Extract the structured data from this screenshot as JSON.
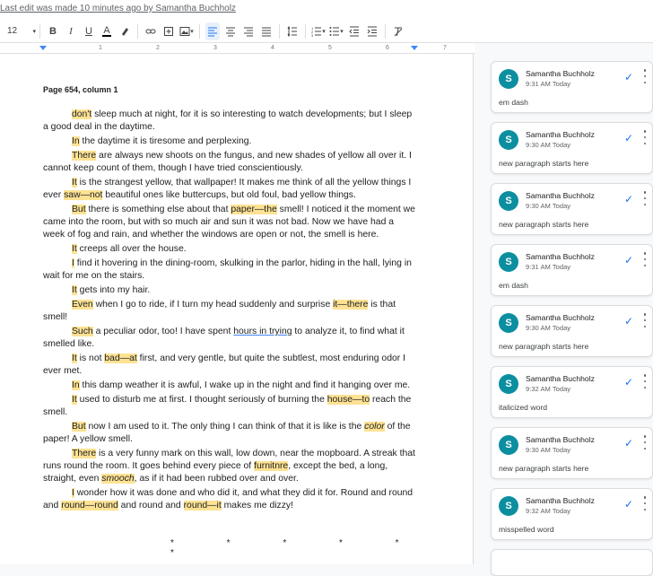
{
  "topbar": {
    "last_edit": "Last edit was made 10 minutes ago by Samantha Buchholz"
  },
  "toolbar": {
    "font_size": "12",
    "icons": [
      "bold-icon",
      "italic-icon",
      "underline-icon",
      "text-color-icon",
      "highlight-icon",
      "link-icon",
      "comment-icon",
      "image-icon",
      "align-left-icon",
      "align-center-icon",
      "align-right-icon",
      "justify-icon",
      "line-spacing-icon",
      "numbered-list-icon",
      "bulleted-list-icon",
      "decrease-indent-icon",
      "increase-indent-icon",
      "clear-formatting-icon"
    ],
    "bold": "B",
    "italic": "I",
    "underline": "U",
    "text_color": "A"
  },
  "ruler": {
    "ticks": [
      "1",
      "2",
      "3",
      "4",
      "5",
      "6",
      "7"
    ]
  },
  "document": {
    "heading": "Page 654, column 1",
    "paragraphs": [
      {
        "a": "don't",
        " b": "",
        "rest": " sleep much at night, for it is so interesting to watch developments; but I sleep a good deal in the daytime."
      },
      {
        "a": "In",
        "rest": " the daytime it is tiresome and perplexing."
      },
      {
        "a": "There",
        "rest": " are always new shoots on the fungus, and new shades of yellow all over it. I cannot keep count of them, though I have tried conscientiously."
      },
      {
        "a": "It",
        "rest1": " is the strangest yellow, that wallpaper! It makes me think of all the yellow things I ever ",
        "b": "saw—not",
        "rest2": " beautiful ones like buttercups, but old foul, bad yellow things."
      },
      {
        "a": "But",
        "rest1": " there is something else about that ",
        "b": "paper—the",
        "rest2": " smell! I noticed it the moment we came into the room, but with so much air and sun it was not bad. Now we have had a week of fog and rain, and whether the windows are open or not, the smell is here."
      },
      {
        "a": "It",
        "rest": " creeps all over the house."
      },
      {
        "a": "I",
        "rest": " find it hovering in the dining-room, skulking in the parlor, hiding in the hall, lying in wait for me on the stairs."
      },
      {
        "a": "It",
        "rest": " gets into my hair."
      },
      {
        "a": "Even",
        "rest1": " when I go to ride, if I turn my head suddenly and surprise ",
        "b": "it—there",
        "rest2": " is that smell!"
      },
      {
        "a": "Such",
        "rest1": " a peculiar odor, too! I have spent ",
        "u": "hours in trying",
        "rest2": " to analyze it, to find what it smelled like."
      },
      {
        "a": "It",
        "rest1": " is not ",
        "b": "bad—at",
        "rest2": " first, and very gentle, but quite the subtlest, most enduring odor I ever met."
      },
      {
        "a": "In",
        "rest": " this damp weather it is awful, I wake up in the night and find it hanging over me."
      },
      {
        "a": "It",
        "rest1": " used to disturb me at first. I thought seriously of burning the ",
        "b": "house—to",
        "rest2": " reach the smell."
      },
      {
        "a": "But",
        "rest1": " now I am used to it. The only thing I can think of that it is like is the ",
        "b": "color",
        "rest2": " of the paper! A yellow smell."
      },
      {
        "a": "There",
        "rest1": " is a very funny mark on this wall, low down, near the mopboard. A streak that runs round the room. It goes behind every piece of ",
        "b": "furnitnre",
        "rest2": ", except the bed, a long, straight, even ",
        "c": "smooch",
        "rest3": ", as if it had been rubbed over and over."
      },
      {
        "a": "I",
        "rest1": " wonder how it was done and who did it, and what they did it for. Round and round and ",
        "b": "round—round",
        "rest2": " and round and ",
        "c": "round—it",
        "rest3": " makes me dizzy!"
      }
    ],
    "divider": "* * * * * *"
  },
  "comments": [
    {
      "author": "Samantha Buchholz",
      "time": "9:31 AM Today",
      "text": "em dash",
      "initial": "S"
    },
    {
      "author": "Samantha Buchholz",
      "time": "9:30 AM Today",
      "text": "new paragraph starts here",
      "initial": "S"
    },
    {
      "author": "Samantha Buchholz",
      "time": "9:30 AM Today",
      "text": "new paragraph starts here",
      "initial": "S"
    },
    {
      "author": "Samantha Buchholz",
      "time": "9:31 AM Today",
      "text": "em dash",
      "initial": "S"
    },
    {
      "author": "Samantha Buchholz",
      "time": "9:30 AM Today",
      "text": "new paragraph starts here",
      "initial": "S"
    },
    {
      "author": "Samantha Buchholz",
      "time": "9:32 AM Today",
      "text": "italicized word",
      "initial": "S"
    },
    {
      "author": "Samantha Buchholz",
      "time": "9:30 AM Today",
      "text": "new paragraph starts here",
      "initial": "S"
    },
    {
      "author": "Samantha Buchholz",
      "time": "9:32 AM Today",
      "text": "misspelled word",
      "initial": "S"
    }
  ],
  "colors": {
    "highlight": "#fde293",
    "avatar": "#0b8fa0",
    "accent": "#1a73e8"
  }
}
